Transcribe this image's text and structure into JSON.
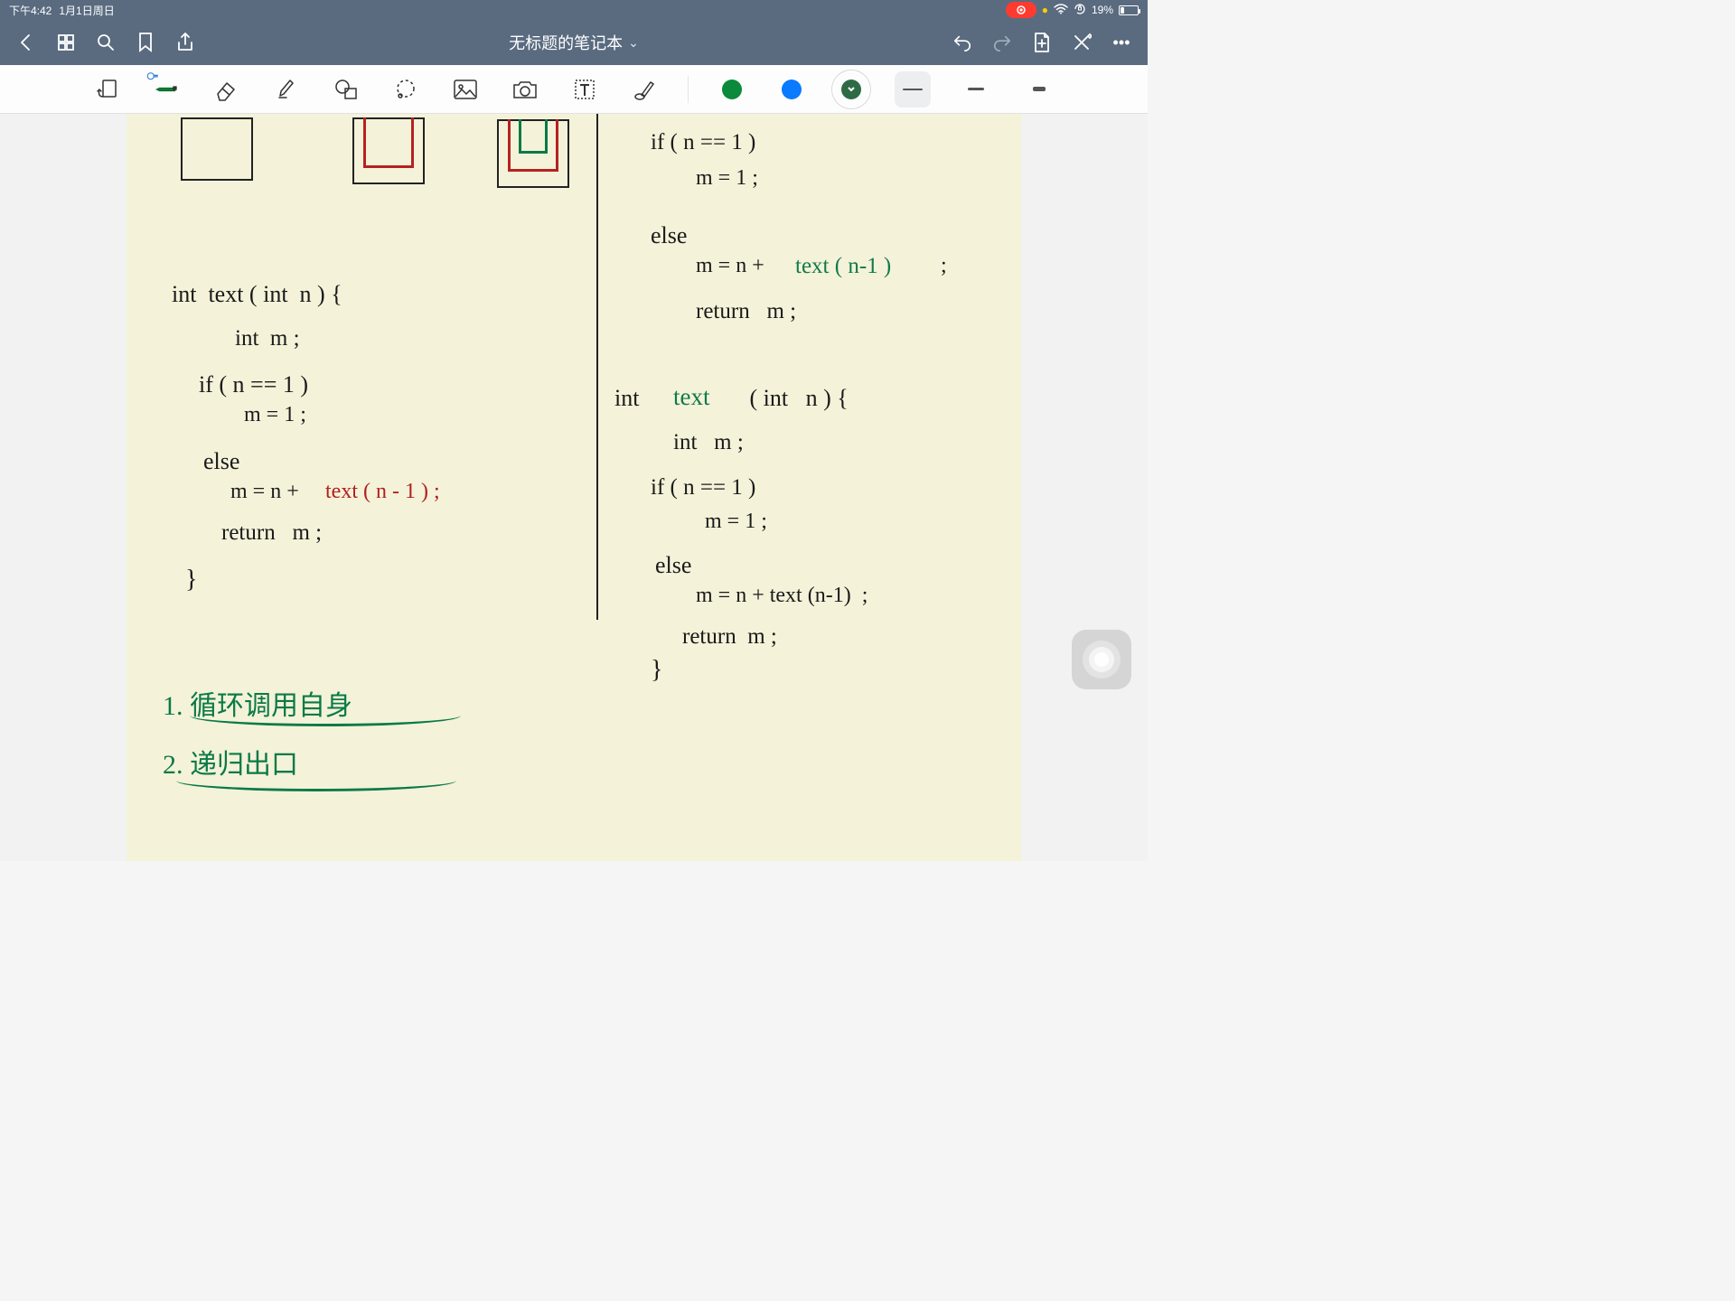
{
  "status": {
    "time": "下午4:42",
    "date": "1月1日周日",
    "battery_pct": "19%"
  },
  "nav": {
    "title": "无标题的笔记本",
    "chevron": "⌄"
  },
  "toolbar": {
    "tools": {
      "doc_convert": "doc-convert",
      "pen": "pen",
      "eraser": "eraser",
      "highlighter": "highlighter",
      "shape": "shape",
      "lasso": "lasso",
      "image": "image",
      "camera": "camera",
      "text": "text",
      "pointer": "pointer"
    },
    "colors": {
      "green": "#0a8a3a",
      "blue": "#0a7aff",
      "dark_green": "#2e6b45"
    },
    "strokes": {
      "thin": "thin",
      "med": "medium",
      "thick": "thick"
    }
  },
  "handwriting": {
    "left_code": {
      "l1": "int  text ( int  n ) {",
      "l2": "int  m ;",
      "l3": "if ( n == 1 )",
      "l4": "m = 1 ;",
      "l5": "else",
      "l6a": "m = n + ",
      "l6b": "text ( n - 1 ) ;",
      "l7": "return   m ;",
      "l8": "}"
    },
    "right_top": {
      "l1": "if ( n == 1 )",
      "l2": "m = 1 ;",
      "l3": "else",
      "l4a": "m = n + ",
      "l4b": "text ( n-1 )",
      "l4c": " ;",
      "l5": "return   m ;"
    },
    "right_bottom": {
      "l1a": "int  ",
      "l1b": "text",
      "l1c": "   ( int   n ) {",
      "l2": "int   m ;",
      "l3": "if ( n == 1 )",
      "l4": "m = 1 ;",
      "l5": "else",
      "l6": "m = n + text (n-1)  ;",
      "l7": "return  m ;",
      "l8": "}"
    },
    "notes": {
      "n1": "1. 循环调用自身",
      "n2": "2. 递归出口"
    }
  }
}
